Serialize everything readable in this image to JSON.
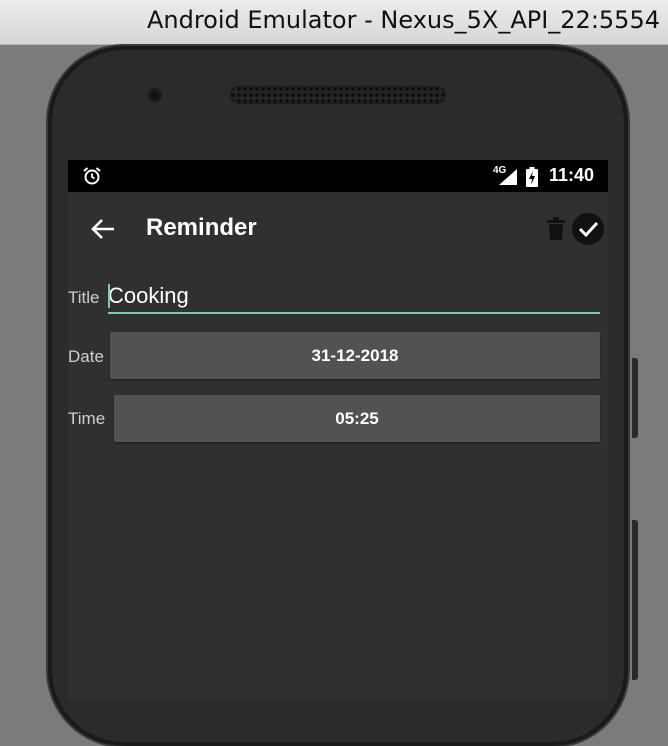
{
  "window": {
    "title": "Android Emulator - Nexus_5X_API_22:5554"
  },
  "status_bar": {
    "network_type": "4G",
    "time": "11:40"
  },
  "app_bar": {
    "title": "Reminder"
  },
  "form": {
    "title_label": "Title",
    "title_value": "Cooking",
    "date_label": "Date",
    "date_value": "31-12-2018",
    "time_label": "Time",
    "time_value": "05:25"
  },
  "colors": {
    "accent": "#7fc8bd",
    "background": "#303030",
    "button": "#525252"
  }
}
